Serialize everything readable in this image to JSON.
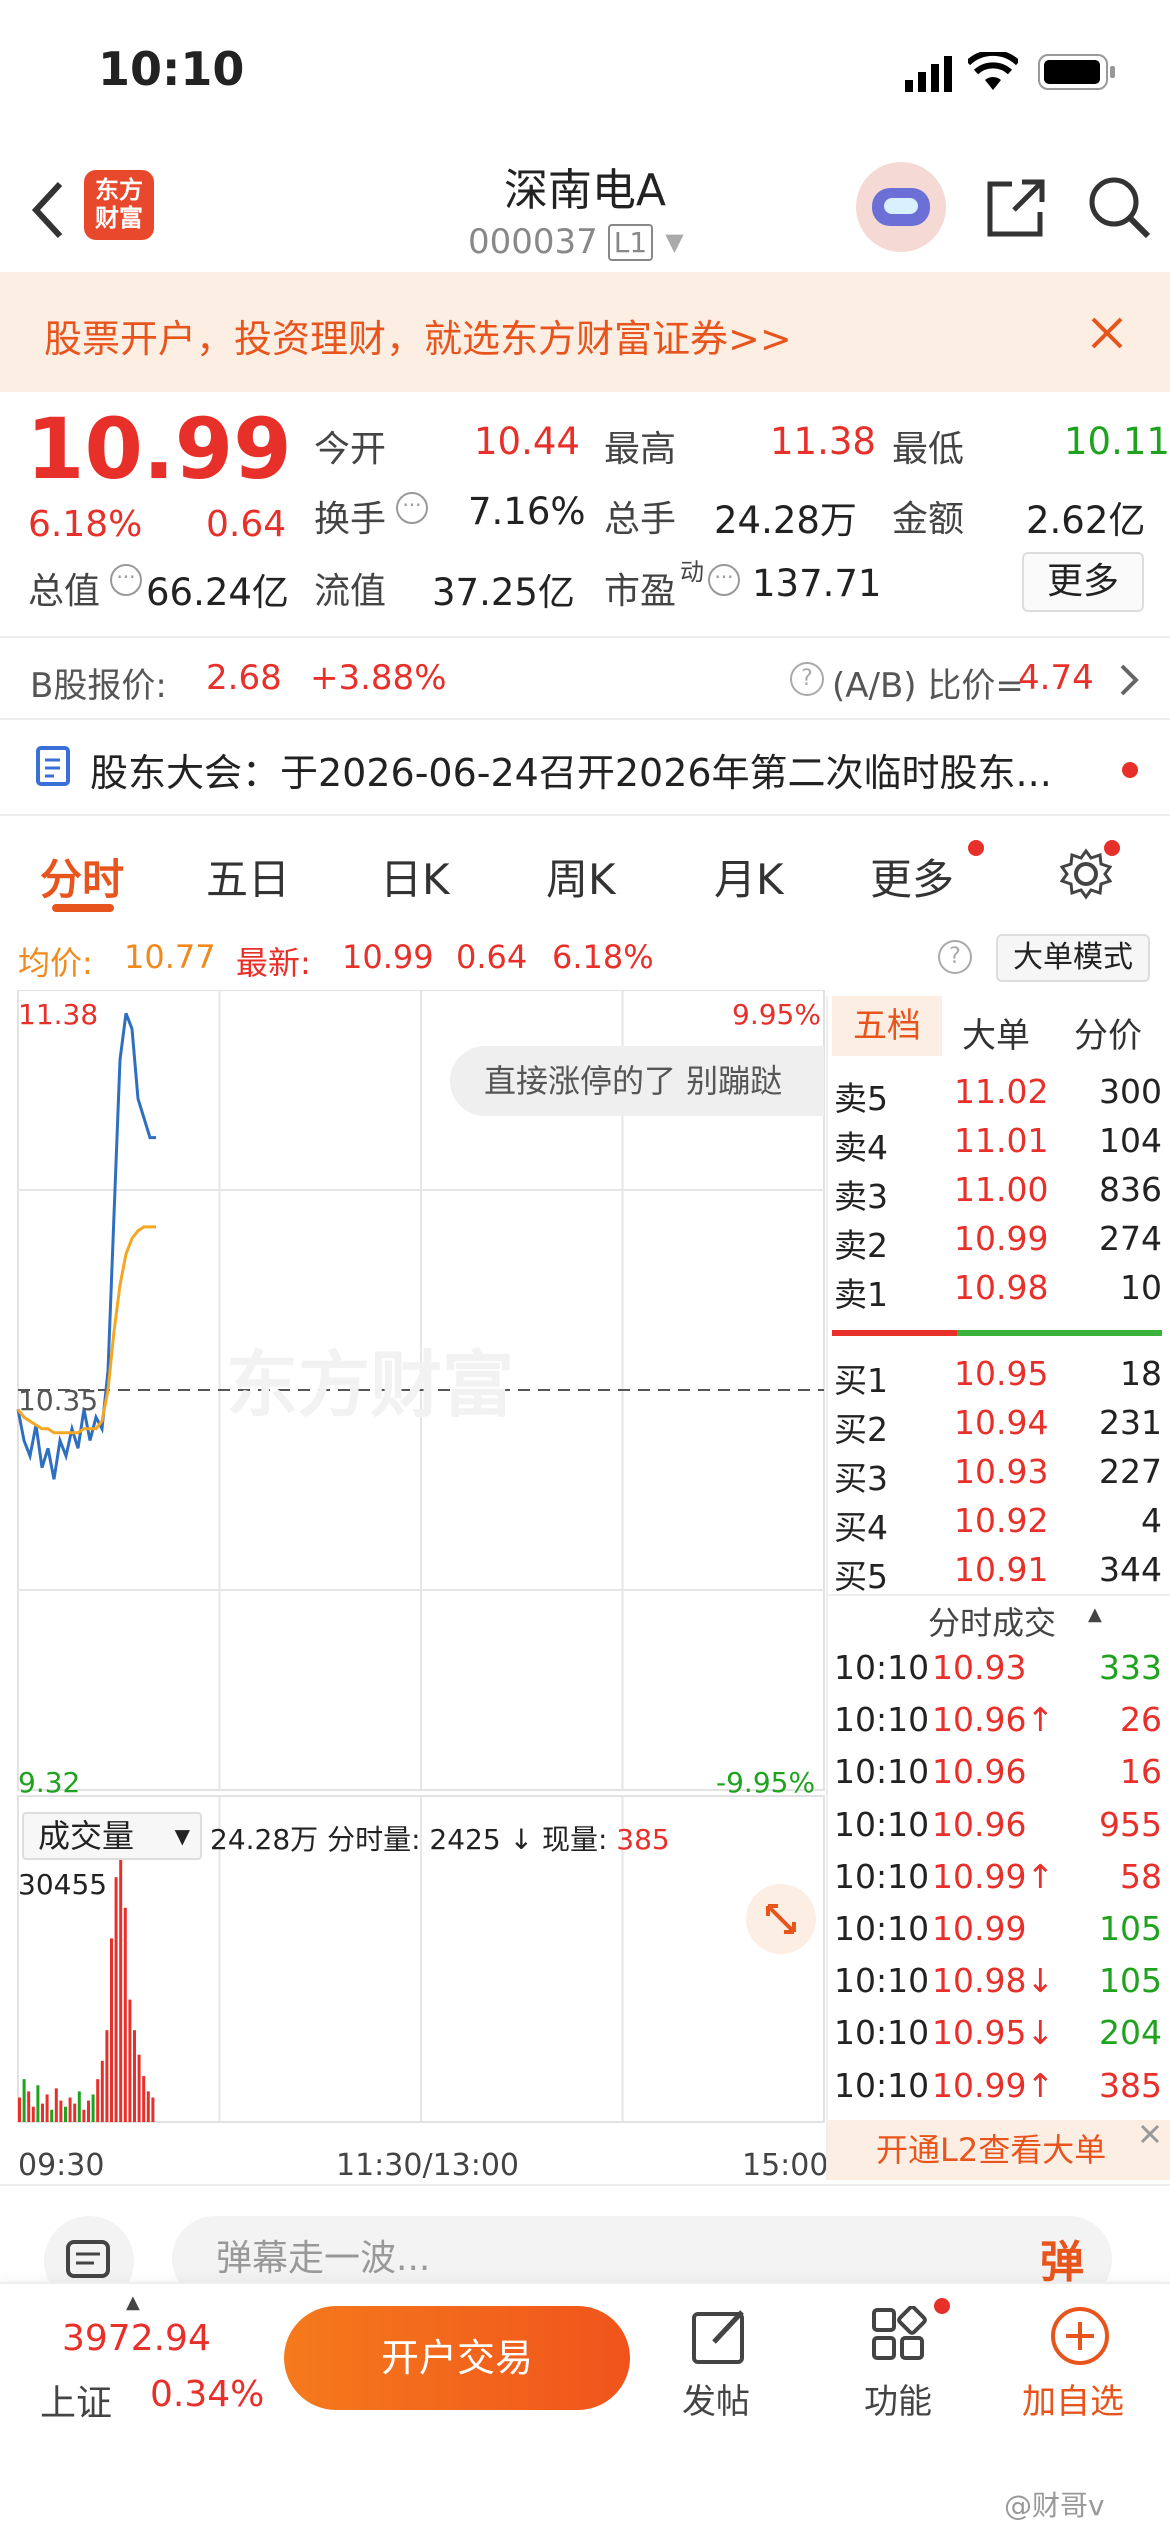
{
  "status": {
    "time": "10:10"
  },
  "header": {
    "logo": "东方\n财富",
    "title": "深南电A",
    "code": "000037",
    "level": "L1"
  },
  "banner": {
    "text": "股票开户，投资理财，就选东方财富证券>>"
  },
  "quote": {
    "price": "10.99",
    "change_pct": "6.18%",
    "change": "0.64",
    "open_label": "今开",
    "open": "10.44",
    "high_label": "最高",
    "high": "11.38",
    "low_label": "最低",
    "low": "10.11",
    "turnover_label": "换手",
    "turnover": "7.16%",
    "volume_label": "总手",
    "volume": "24.28万",
    "amount_label": "金额",
    "amount": "2.62亿",
    "mktcap_label": "总值",
    "mktcap": "66.24亿",
    "float_label": "流值",
    "float": "37.25亿",
    "pe_label": "市盈",
    "pe_sup": "动",
    "pe": "137.71",
    "more": "更多"
  },
  "bshare": {
    "label": "B股报价:",
    "price": "2.68",
    "pct": "+3.88%",
    "ratio_label": "(A/B) 比价=",
    "ratio": "4.74"
  },
  "notice": {
    "text": "股东大会：于2026-06-24召开2026年第二次临时股东..."
  },
  "tabs": [
    "分时",
    "五日",
    "日K",
    "周K",
    "月K",
    "更多"
  ],
  "chart_info": {
    "avg_label": "均价:",
    "avg": "10.77",
    "last_label": "最新:",
    "last": "10.99",
    "chg": "0.64",
    "pct": "6.18%",
    "mode": "大单模式"
  },
  "chart_data": {
    "type": "line",
    "ylim": [
      9.32,
      11.38
    ],
    "yticks_left": [
      "11.38",
      "10.35",
      "9.32"
    ],
    "yticks_right": [
      "9.95%",
      "-9.95%"
    ],
    "xticks": [
      "09:30",
      "11:30/13:00",
      "15:00"
    ],
    "danmaku": "直接涨停的了 别蹦跶",
    "watermark": "东方财富",
    "series": [
      {
        "name": "价格",
        "color": "#2f6fc0",
        "values": [
          10.3,
          10.22,
          10.18,
          10.26,
          10.15,
          10.2,
          10.12,
          10.22,
          10.18,
          10.25,
          10.2,
          10.3,
          10.22,
          10.28,
          10.25,
          10.4,
          10.8,
          11.2,
          11.32,
          11.28,
          11.1,
          11.05,
          11.0,
          11.0
        ]
      },
      {
        "name": "均价",
        "color": "#f5a623",
        "values": [
          10.3,
          10.28,
          10.27,
          10.26,
          10.25,
          10.25,
          10.24,
          10.24,
          10.24,
          10.24,
          10.24,
          10.25,
          10.25,
          10.25,
          10.27,
          10.35,
          10.5,
          10.62,
          10.7,
          10.74,
          10.76,
          10.77,
          10.77,
          10.77
        ]
      }
    ],
    "volume": {
      "label": "成交量",
      "total": "24.28万",
      "per_label": "分时量:",
      "per": "2425",
      "now_label": "现量:",
      "now": "385",
      "max": "30455",
      "values": [
        8,
        14,
        10,
        5,
        12,
        6,
        9,
        4,
        11,
        7,
        5,
        8,
        6,
        10,
        4,
        7,
        9,
        14,
        20,
        30,
        60,
        80,
        100,
        70,
        40,
        30,
        22,
        15,
        10,
        8
      ]
    }
  },
  "depth": {
    "tabs": [
      "五档",
      "大单",
      "分价"
    ],
    "asks": [
      {
        "l": "卖5",
        "p": "11.02",
        "v": "300"
      },
      {
        "l": "卖4",
        "p": "11.01",
        "v": "104"
      },
      {
        "l": "卖3",
        "p": "11.00",
        "v": "836"
      },
      {
        "l": "卖2",
        "p": "10.99",
        "v": "274"
      },
      {
        "l": "卖1",
        "p": "10.98",
        "v": "10"
      }
    ],
    "bids": [
      {
        "l": "买1",
        "p": "10.95",
        "v": "18"
      },
      {
        "l": "买2",
        "p": "10.94",
        "v": "231"
      },
      {
        "l": "买3",
        "p": "10.93",
        "v": "227"
      },
      {
        "l": "买4",
        "p": "10.92",
        "v": "4"
      },
      {
        "l": "买5",
        "p": "10.91",
        "v": "344"
      }
    ],
    "ticks_title": "分时成交",
    "ticks": [
      {
        "t": "10:10",
        "p": "10.93",
        "v": "333",
        "a": "",
        "c": "green"
      },
      {
        "t": "10:10",
        "p": "10.96",
        "v": "26",
        "a": "↑",
        "c": "red"
      },
      {
        "t": "10:10",
        "p": "10.96",
        "v": "16",
        "a": "",
        "c": "red"
      },
      {
        "t": "10:10",
        "p": "10.96",
        "v": "955",
        "a": "",
        "c": "red"
      },
      {
        "t": "10:10",
        "p": "10.99",
        "v": "58",
        "a": "↑",
        "c": "red"
      },
      {
        "t": "10:10",
        "p": "10.99",
        "v": "105",
        "a": "",
        "c": "green"
      },
      {
        "t": "10:10",
        "p": "10.98",
        "v": "105",
        "a": "↓",
        "c": "green"
      },
      {
        "t": "10:10",
        "p": "10.95",
        "v": "204",
        "a": "↓",
        "c": "green"
      },
      {
        "t": "10:10",
        "p": "10.99",
        "v": "385",
        "a": "↑",
        "c": "red"
      }
    ],
    "l2": "开通L2查看大单"
  },
  "danmaku_input": {
    "placeholder": "弹幕走一波...",
    "btn": "弹"
  },
  "bottom": {
    "index_value": "3972.94",
    "index_name": "上证",
    "index_pct": "0.34%",
    "trade": "开户交易",
    "post": "发帖",
    "func": "功能",
    "add": "加自选"
  },
  "watermark": "@财哥v"
}
